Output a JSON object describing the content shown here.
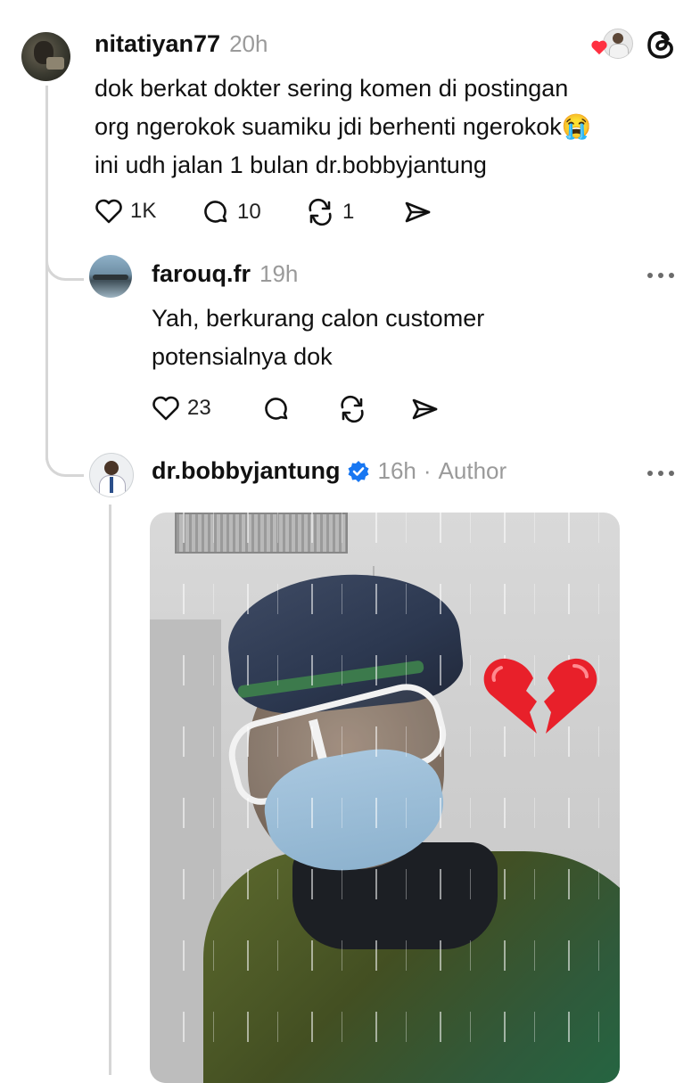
{
  "post": {
    "username": "nitatiyan77",
    "time": "20h",
    "text_lines": [
      "dok berkat dokter sering komen di postingan",
      "org ngerokok suamiku jdi berhenti ngerokok😭",
      "ini udh jalan 1 bulan dr.bobbyjantung"
    ],
    "likes": "1K",
    "replies": "10",
    "reposts": "1"
  },
  "reply1": {
    "username": "farouq.fr",
    "time": "19h",
    "text_lines": [
      "Yah, berkurang calon customer",
      "potensialnya dok"
    ],
    "likes": "23"
  },
  "reply2": {
    "username": "dr.bobbyjantung",
    "time": "16h",
    "separator": "·",
    "badge": "Author"
  },
  "icons": {
    "liked_by": "heart-icon",
    "brand": "threads-logo-icon",
    "verified": "verified-badge-icon"
  },
  "colors": {
    "verified": "#1877f2",
    "heart": "#ff3040"
  }
}
